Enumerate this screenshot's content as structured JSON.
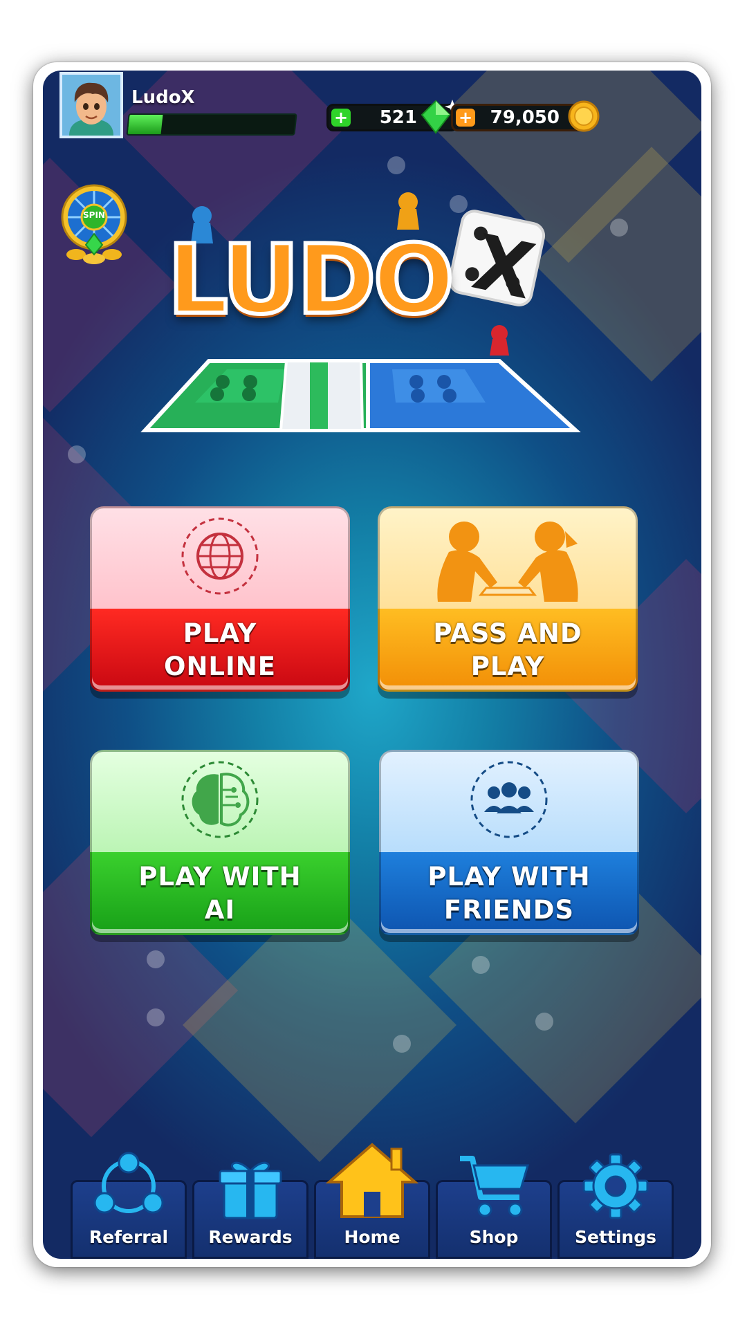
{
  "player": {
    "name": "LudoX",
    "xp_progress": 0.2
  },
  "currency": {
    "gems": {
      "value": "521",
      "icon": "gem-icon",
      "accent": "#2fd42a"
    },
    "coins": {
      "value": "79,050",
      "icon": "coin-icon",
      "accent": "#ff9a1a"
    }
  },
  "spin": {
    "label": "SPIN"
  },
  "logo": {
    "text": "LUDO",
    "suffix": "X"
  },
  "modes": [
    {
      "line1": "PLAY",
      "line2": "ONLINE",
      "icon": "globe-icon"
    },
    {
      "line1": "PASS AND",
      "line2": "PLAY",
      "icon": "kids-playing-icon"
    },
    {
      "line1": "PLAY WITH",
      "line2": "AI",
      "icon": "brain-icon"
    },
    {
      "line1": "PLAY WITH",
      "line2": "FRIENDS",
      "icon": "group-icon"
    }
  ],
  "nav": [
    {
      "label": "Referral",
      "icon": "referral-icon"
    },
    {
      "label": "Rewards",
      "icon": "gift-icon"
    },
    {
      "label": "Home",
      "icon": "home-icon",
      "active": true
    },
    {
      "label": "Shop",
      "icon": "cart-icon"
    },
    {
      "label": "Settings",
      "icon": "gear-icon"
    }
  ]
}
